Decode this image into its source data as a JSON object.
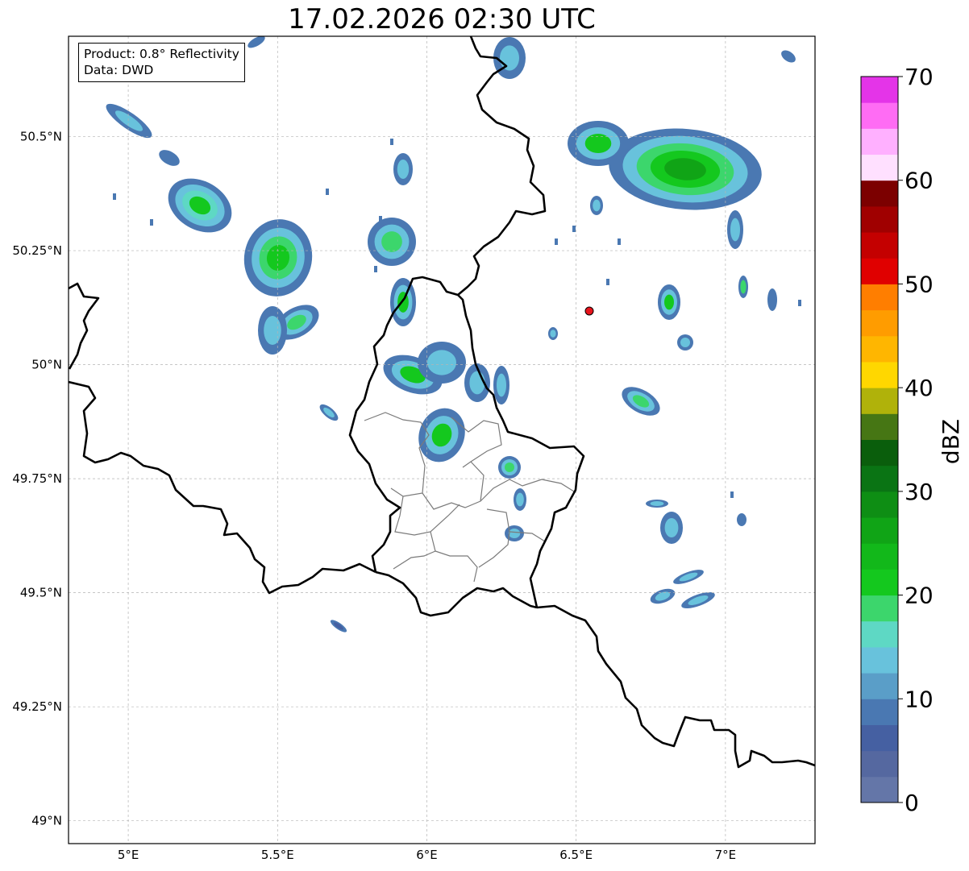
{
  "title": "17.02.2026 02:30 UTC",
  "info_box": {
    "product": "Product: 0.8° Reflectivity",
    "source": "Data: DWD"
  },
  "map": {
    "extent": {
      "lon": [
        4.8,
        7.3
      ],
      "lat": [
        48.95,
        50.72
      ]
    },
    "lon_ticks": [
      {
        "value": 5.0,
        "label": "5°E"
      },
      {
        "value": 5.5,
        "label": "5.5°E"
      },
      {
        "value": 6.0,
        "label": "6°E"
      },
      {
        "value": 6.5,
        "label": "6.5°E"
      },
      {
        "value": 7.0,
        "label": "7°E"
      }
    ],
    "lat_ticks": [
      {
        "value": 49.0,
        "label": "49°N"
      },
      {
        "value": 49.25,
        "label": "49.25°N"
      },
      {
        "value": 49.5,
        "label": "49.5°N"
      },
      {
        "value": 49.75,
        "label": "49.75°N"
      },
      {
        "value": 50.0,
        "label": "50°N"
      },
      {
        "value": 50.25,
        "label": "50.25°N"
      },
      {
        "value": 50.5,
        "label": "50.5°N"
      }
    ],
    "gridlines": true,
    "radar_site_color": "#e8141c"
  },
  "colorbar": {
    "label": "dBZ",
    "ticks": [
      "0",
      "10",
      "20",
      "30",
      "40",
      "50",
      "60",
      "70"
    ],
    "colors": [
      "#6476a8",
      "#5568a0",
      "#4560a2",
      "#4a78b2",
      "#5a9ec8",
      "#68c2dc",
      "#5ed8c4",
      "#3cd66c",
      "#14c81e",
      "#12b81a",
      "#10a416",
      "#0e8e14",
      "#0a7414",
      "#0a5e0c",
      "#467614",
      "#b0b20a",
      "#ffd700",
      "#ffb600",
      "#ff9c00",
      "#ff7e00",
      "#e00000",
      "#c40000",
      "#a00000",
      "#7c0000",
      "#ffe0ff",
      "#ffb0ff",
      "#ff6cf4",
      "#e434e8"
    ]
  }
}
